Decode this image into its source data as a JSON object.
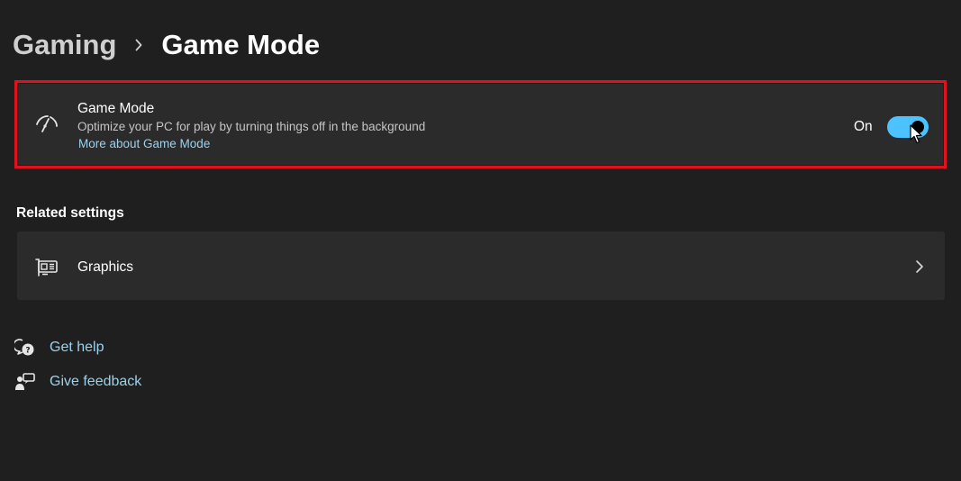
{
  "breadcrumb": {
    "parent": "Gaming",
    "current": "Game Mode"
  },
  "game_mode": {
    "title": "Game Mode",
    "description": "Optimize your PC for play by turning things off in the background",
    "link": "More about Game Mode",
    "toggle_state": "On",
    "toggle_on": true,
    "icon": "gauge-icon",
    "highlight_color": "#e0121e"
  },
  "related": {
    "heading": "Related settings",
    "items": [
      {
        "label": "Graphics",
        "icon": "graphics-card-icon"
      }
    ]
  },
  "help": {
    "get_help": "Get help",
    "give_feedback": "Give feedback"
  },
  "colors": {
    "accent": "#4cc2ff",
    "link": "#9ad2ec",
    "background": "#1f1f1f",
    "card": "#2b2b2b"
  }
}
